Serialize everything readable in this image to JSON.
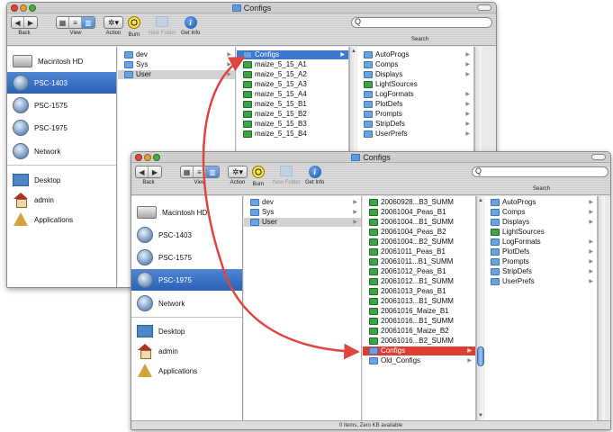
{
  "colors": {
    "selection": "#3f78cf",
    "annotation": "#e0443e"
  },
  "icons": [
    "back-icon",
    "forward-icon",
    "view-icon",
    "gear-icon",
    "burn-icon",
    "new-folder-icon",
    "info-icon",
    "search-icon",
    "folder-icon",
    "document-icon",
    "hard-drive-icon",
    "network-globe-icon",
    "desktop-icon",
    "home-icon",
    "applications-icon"
  ],
  "window_back": {
    "title": "Configs",
    "toolbar": {
      "back": "Back",
      "view": "View",
      "action": "Action",
      "burn": "Burn",
      "new_folder": "New Folder",
      "get_info": "Get Info",
      "search": "Search",
      "search_glyph": "Q"
    },
    "sidebar": {
      "drive": "Macintosh HD",
      "hosts": [
        "PSC-1403",
        "PSC-1575",
        "PSC-1975"
      ],
      "network": "Network",
      "places": [
        "Desktop",
        "admin",
        "Applications"
      ]
    },
    "col1": [
      "dev",
      "Sys",
      "User"
    ],
    "col2": [
      "Configs",
      "maize_5_15_A1",
      "maize_5_15_A2",
      "maize_5_15_A3",
      "maize_5_15_A4",
      "maize_5_15_B1",
      "maize_5_15_B2",
      "maize_5_15_B3",
      "maize_5_15_B4"
    ],
    "col3": [
      "AutoProgs",
      "Comps",
      "Displays",
      "LightSources",
      "LogFormats",
      "PlotDefs",
      "Prompts",
      "StripDefs",
      "UserPrefs"
    ]
  },
  "window_front": {
    "title": "Configs",
    "toolbar": {
      "back": "Back",
      "view": "View",
      "action": "Action",
      "burn": "Burn",
      "new_folder": "New Folder",
      "get_info": "Get Info",
      "search": "Search",
      "search_glyph": "Q"
    },
    "sidebar": {
      "drive": "Macintosh HD",
      "hosts": [
        "PSC-1403",
        "PSC-1575",
        "PSC-1975"
      ],
      "network": "Network",
      "places": [
        "Desktop",
        "admin",
        "Applications"
      ]
    },
    "col1": [
      "dev",
      "Sys",
      "User"
    ],
    "col2": [
      "20060928...B3_SUMM",
      "20061004_Peas_B1",
      "20061004...B1_SUMM",
      "20061004_Peas_B2",
      "20061004...B2_SUMM",
      "20061011_Peas_B1",
      "20061011...B1_SUMM",
      "20061012_Peas_B1",
      "20061012...B1_SUMM",
      "20061013_Peas_B1",
      "20061013...B1_SUMM",
      "20061016_Maize_B1",
      "20061016...B1_SUMM",
      "20061016_Maize_B2",
      "20061016...B2_SUMM",
      "Configs",
      "Old_Configs"
    ],
    "col3": [
      "AutoProgs",
      "Comps",
      "Displays",
      "LightSources",
      "LogFormats",
      "PlotDefs",
      "Prompts",
      "StripDefs",
      "UserPrefs"
    ],
    "status": "0 items, Zero KB available"
  }
}
